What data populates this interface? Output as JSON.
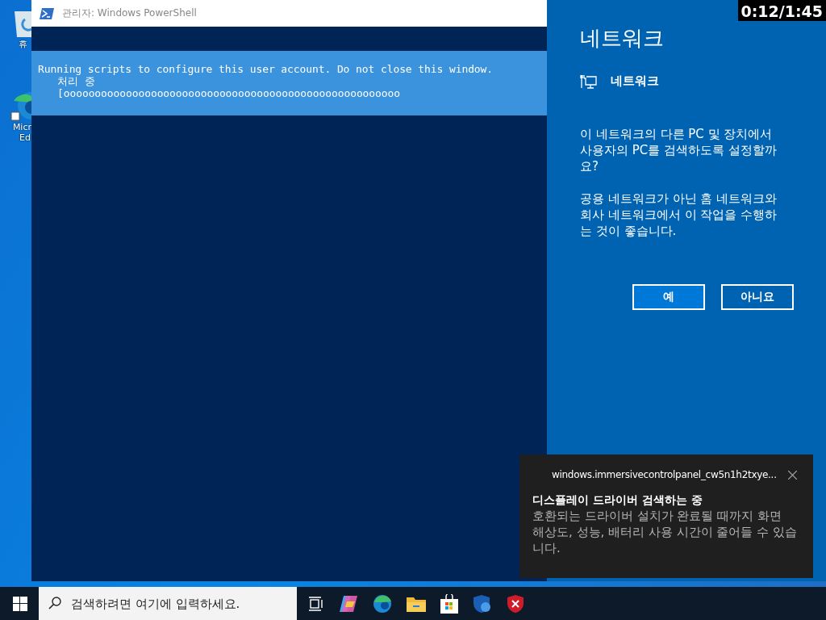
{
  "desktop_icons": [
    {
      "kind": "recycle-bin",
      "lines": [
        "휴"
      ]
    },
    {
      "kind": "edge",
      "lines": [
        "Micr",
        "Ed"
      ]
    }
  ],
  "powershell": {
    "title": "관리자: Windows PowerShell",
    "progress": {
      "message": "Running scripts to configure this user account. Do not close this window.",
      "activity": "처리 중",
      "bar": "[oooooooooooooooooooooooooooooooooooooooooooooooooooooo"
    }
  },
  "network_flyout": {
    "title": "네트워크",
    "network_name": "네트워크",
    "paragraphs": [
      "이 네트워크의 다른 PC 및 장치에서 사용자의 PC를 검색하도록 설정할까요?",
      "공용 네트워크가 아닌 홈 네트워크와 회사 네트워크에서 이 작업을 수행하는 것이 좋습니다."
    ],
    "buttons": [
      {
        "label": "예",
        "primary": true
      },
      {
        "label": "아니요",
        "primary": false
      }
    ]
  },
  "timestamp": "0:12/1:45",
  "toast": {
    "app": "windows.immersivecontrolpanel_cw5n1h2txye...",
    "title": "디스플레이 드라이버 검색하는 중",
    "body": "호환되는 드라이버 설치가 완료될 때까지 화면 해상도, 성능, 배터리 사용 시간이 줄어들 수 있습니다."
  },
  "taskbar": {
    "search": {
      "placeholder": "검색하려면 여기에 입력하세요."
    },
    "apps": [
      {
        "kind": "task-view"
      },
      {
        "kind": "copilot"
      },
      {
        "kind": "edge"
      },
      {
        "kind": "explorer"
      },
      {
        "kind": "store"
      },
      {
        "kind": "security"
      },
      {
        "kind": "defender-alert"
      }
    ]
  }
}
